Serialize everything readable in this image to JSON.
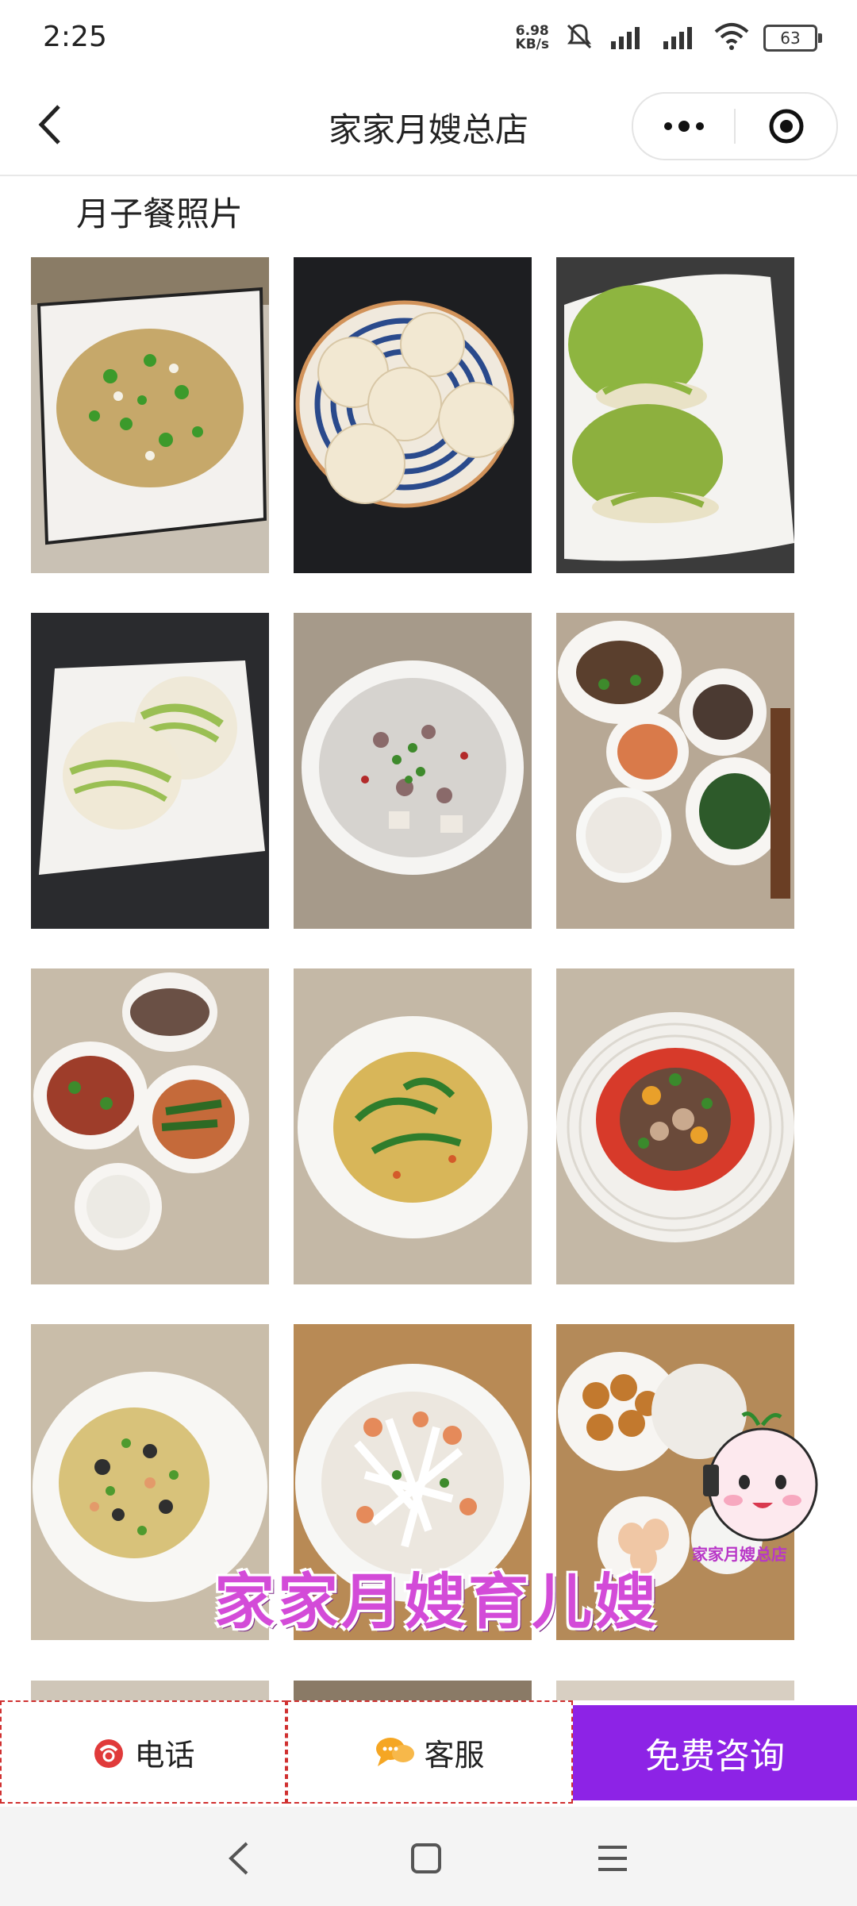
{
  "status_bar": {
    "time": "2:25",
    "net_speed_value": "6.98",
    "net_speed_unit": "KB/s",
    "battery": "63"
  },
  "nav": {
    "title": "家家月嫂总店"
  },
  "section": {
    "title": "月子餐照片"
  },
  "photos": [
    {
      "name": "fried-rice-with-scallion"
    },
    {
      "name": "steamed-buns-striped-plate"
    },
    {
      "name": "green-spiral-buns"
    },
    {
      "name": "green-spiral-buns-2"
    },
    {
      "name": "congee-with-meat"
    },
    {
      "name": "set-meal-four-dishes"
    },
    {
      "name": "set-meal-fish"
    },
    {
      "name": "vegetable-soup"
    },
    {
      "name": "beef-with-tomato"
    },
    {
      "name": "fried-rice-mixed"
    },
    {
      "name": "shrimp-radish"
    },
    {
      "name": "eggs-and-cakes"
    }
  ],
  "watermark": {
    "text": "家家月嫂育儿嫂",
    "mascot_label": "家家月嫂总店"
  },
  "bottom_bar": {
    "phone_label": "电话",
    "service_label": "客服",
    "consult_label": "免费咨询"
  },
  "colors": {
    "accent": "#8d23e6",
    "watermark": "#d34bd8",
    "phone_icon": "#e03a3a",
    "service_icon": "#f5a623"
  }
}
